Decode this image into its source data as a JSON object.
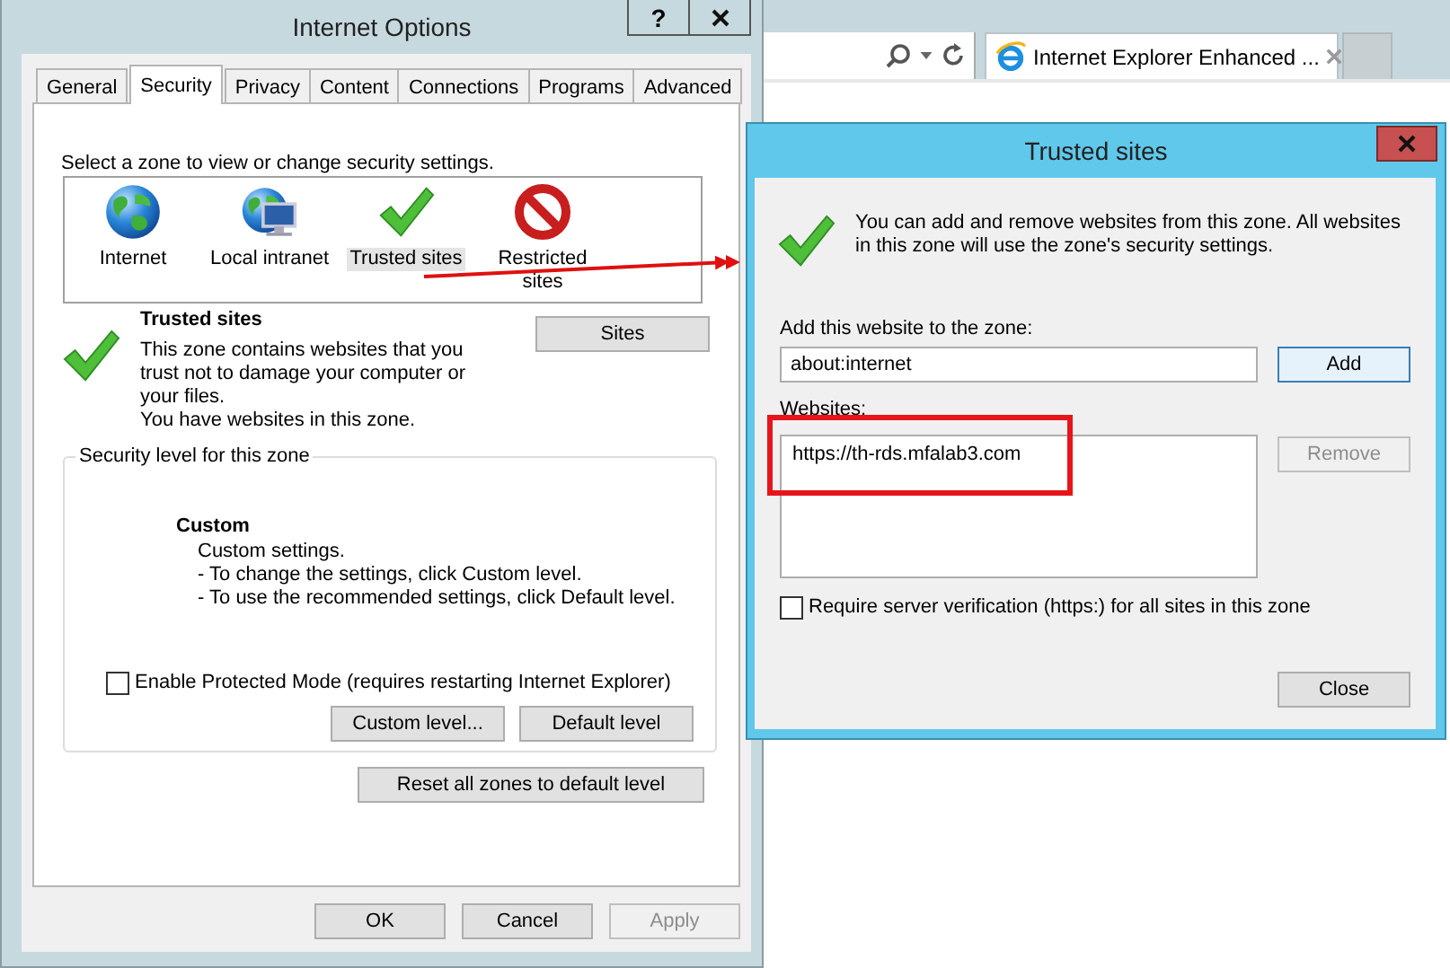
{
  "browser": {
    "tab_title": "Internet Explorer Enhanced ..."
  },
  "internet_options": {
    "title": "Internet Options",
    "active": false,
    "help": "?",
    "tabs": [
      {
        "label": "General",
        "selected": false
      },
      {
        "label": "Security",
        "selected": true
      },
      {
        "label": "Privacy",
        "selected": false
      },
      {
        "label": "Content",
        "selected": false
      },
      {
        "label": "Connections",
        "selected": false
      },
      {
        "label": "Programs",
        "selected": false
      },
      {
        "label": "Advanced",
        "selected": false
      }
    ],
    "zone_prompt": "Select a zone to view or change security settings.",
    "zones": [
      {
        "label": "Internet",
        "kind": "globe",
        "selected": false
      },
      {
        "label": "Local intranet",
        "kind": "intranet",
        "selected": false
      },
      {
        "label": "Trusted sites",
        "kind": "check",
        "selected": true
      },
      {
        "label": "Restricted sites",
        "kind": "blocked",
        "selected": false
      }
    ],
    "zone_name": "Trusted sites",
    "zone_description": "This zone contains websites that you trust not to damage your computer or your files.",
    "zone_note": "You have websites in this zone.",
    "sites_button": "Sites",
    "security_level": {
      "legend": "Security level for this zone",
      "name": "Custom",
      "details": [
        "Custom settings.",
        "- To change the settings, click Custom level.",
        "- To use the recommended settings, click Default level."
      ],
      "protected_mode": {
        "label": "Enable Protected Mode (requires restarting Internet Explorer)",
        "checked": false
      },
      "buttons": [
        {
          "label": "Custom level...",
          "disabled": false
        },
        {
          "label": "Default level",
          "disabled": false
        }
      ]
    },
    "reset_button": "Reset all zones to default level",
    "buttons": [
      {
        "label": "OK",
        "disabled": false
      },
      {
        "label": "Cancel",
        "disabled": false
      },
      {
        "label": "Apply",
        "disabled": true
      }
    ]
  },
  "trusted_sites": {
    "title": "Trusted sites",
    "active": true,
    "message": "You can add and remove websites from this zone. All websites in this zone will use the zone's security settings.",
    "add_label": "Add this website to the zone:",
    "add_value": "about:internet",
    "add_button": {
      "label": "Add",
      "disabled": false,
      "default": true
    },
    "websites_label": "Websites:",
    "websites": [
      {
        "url": "https://th-rds.mfalab3.com",
        "selected": false
      }
    ],
    "remove_button": {
      "label": "Remove",
      "disabled": true,
      "default": false
    },
    "require_https": {
      "label": "Require server verification (https:) for all sites in this zone",
      "checked": false
    },
    "close_button": {
      "label": "Close",
      "disabled": false,
      "default": false
    }
  }
}
